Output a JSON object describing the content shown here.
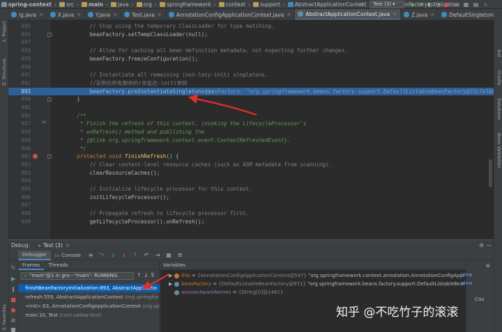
{
  "breadcrumbs": [
    {
      "label": "spring-context",
      "bold": true
    },
    {
      "label": "src"
    },
    {
      "label": "main",
      "bold": true
    },
    {
      "label": "java"
    },
    {
      "label": "org"
    },
    {
      "label": "springframework"
    },
    {
      "label": "context"
    },
    {
      "label": "support"
    },
    {
      "label": "AbstractApplicationContext"
    },
    {
      "label": "finishBeanFactoryInitialization"
    }
  ],
  "run_config": "Test (3)",
  "tabs": [
    {
      "label": "ig.java",
      "active": false
    },
    {
      "label": "X.java",
      "active": false
    },
    {
      "label": "Y.java",
      "active": false
    },
    {
      "label": "Test.java",
      "active": false
    },
    {
      "label": "AnnotationConfigApplicationContext.java",
      "active": false
    },
    {
      "label": "AbstractApplicationContext.java",
      "active": true
    },
    {
      "label": "Z.java",
      "active": false
    },
    {
      "label": "DefaultSingletonBeanRegistry.java",
      "active": false
    }
  ],
  "left_stripe": [
    "1: Project",
    "Z: Structure",
    "2: Favorites"
  ],
  "right_stripe": [
    "Ant",
    "Gradle",
    "Database",
    "Bean Validation"
  ],
  "editor": {
    "lines": [
      {
        "num": "885",
        "text": "        // Stop using the temporary ClassLoader for type matching.",
        "kind": "cm"
      },
      {
        "num": "886",
        "text": "        beanFactory.setTempClassLoader(null);",
        "kind": "code"
      },
      {
        "num": "887",
        "text": "",
        "kind": "code"
      },
      {
        "num": "888",
        "text": "        // Allow for caching all bean definition metadata, not expecting further changes.",
        "kind": "cm"
      },
      {
        "num": "889",
        "text": "        beanFactory.freezeConfiguration();",
        "kind": "code"
      },
      {
        "num": "890",
        "text": "",
        "kind": "code"
      },
      {
        "num": "891",
        "text": "        // Instantiate all remaining (non-lazy-init) singletons.",
        "kind": "cm"
      },
      {
        "num": "892",
        "text": "        //实例化所有剩余的(非延迟-init)单例",
        "kind": "cm"
      },
      {
        "num": "893",
        "text": "        beanFactory.preInstantiateSingletons();",
        "kind": "hl",
        "inline": "beanFactory: \"org.springframework.beans.factory.support.DefaultListableBeanFactory@33c7e1bb"
      },
      {
        "num": "894",
        "text": "    }",
        "kind": "code"
      },
      {
        "num": "895",
        "text": "",
        "kind": "code"
      },
      {
        "num": "896",
        "text": "    /**",
        "kind": "doc"
      },
      {
        "num": "897",
        "text": "     * Finish the refresh of this context, invoking the LifecycleProcessor's",
        "kind": "doc"
      },
      {
        "num": "898",
        "text": "     * onRefresh() method and publishing the",
        "kind": "doc"
      },
      {
        "num": "899",
        "text": "     * {@link org.springframework.context.event.ContextRefreshedEvent}.",
        "kind": "doc"
      },
      {
        "num": "900",
        "text": "     */",
        "kind": "doc"
      },
      {
        "num": "901",
        "text": "    protected void finishRefresh() {",
        "kind": "decl"
      },
      {
        "num": "902",
        "text": "        // Clear context-level resource caches (such as ASM metadata from scanning).",
        "kind": "cm"
      },
      {
        "num": "903",
        "text": "        clearResourceCaches();",
        "kind": "code"
      },
      {
        "num": "904",
        "text": "",
        "kind": "code"
      },
      {
        "num": "905",
        "text": "        // Initialize lifecycle processor for this context.",
        "kind": "cm"
      },
      {
        "num": "906",
        "text": "        initLifecycleProcessor();",
        "kind": "code"
      },
      {
        "num": "907",
        "text": "",
        "kind": "code"
      },
      {
        "num": "908",
        "text": "        // Propagate refresh to lifecycle processor first.",
        "kind": "cm"
      },
      {
        "num": "909",
        "text": "        getLifecycleProcessor().onRefresh();",
        "kind": "code"
      }
    ],
    "decl_keywords": "protected void",
    "decl_fn": "finishRefresh",
    "decl_rest": "() {"
  },
  "debug": {
    "label": "Debug:",
    "session": "Test (3)",
    "tabs": [
      "Debugger",
      "Console"
    ],
    "frames_tabs": [
      "Frames",
      "Threads"
    ],
    "thread_select": "\"main\"@1 in gro···\"main\": RUNNING",
    "frames": [
      {
        "text": "finishBeanFactoryInitialization:893, AbstractApplicatio",
        "loc": "",
        "selected": true
      },
      {
        "text": "refresh:559, AbstractApplicationContext ",
        "loc": "(org.springfra",
        "selected": false
      },
      {
        "text": "<init>:93, AnnotationConfigApplicationContext ",
        "loc": "(org.spr",
        "selected": false
      },
      {
        "text": "main:10, Test ",
        "loc": "(com.sadow.test)",
        "selected": false
      }
    ],
    "variables_label": "Variables",
    "variables": [
      {
        "expand": "▶",
        "name": "this",
        "eq": " = ",
        "type": "{AnnotationConfigApplicationContext@547} ",
        "value": "\"org.springframework.context.annotation.AnnotationConfigApplicationC",
        "color": "#cc7832",
        "field": false,
        "action": "View"
      },
      {
        "expand": "▶",
        "name": "beanFactory",
        "eq": " = ",
        "type": "{DefaultListableBeanFactory@971} ",
        "value": "\"org.springframework.beans.factory.support.DefaultListableBeanFacto",
        "color": "#5f8fa8",
        "field": false,
        "action": "View"
      },
      {
        "expand": "",
        "name": "weaverAwareNames",
        "eq": " = ",
        "type": "{String[0]@1461}",
        "value": "",
        "color": "#5f8fa8",
        "field": true,
        "action": ""
      }
    ],
    "watch_side": [
      "Cou"
    ]
  },
  "watermark": "知乎 @不吃竹子的滚滚",
  "colors": {
    "highlight_line": "#2d6099",
    "selected_frame": "#0d5cab",
    "annotation_arrow": "#e0302b",
    "comment": "#808080",
    "doc": "#629755",
    "keyword": "#cc7832",
    "function": "#ffc66d"
  },
  "icons": [
    "run-icon",
    "debug-icon",
    "stop-icon",
    "resume-icon",
    "pause-icon",
    "step-over-icon",
    "settings-icon",
    "close-icon",
    "breakpoint-icon"
  ]
}
